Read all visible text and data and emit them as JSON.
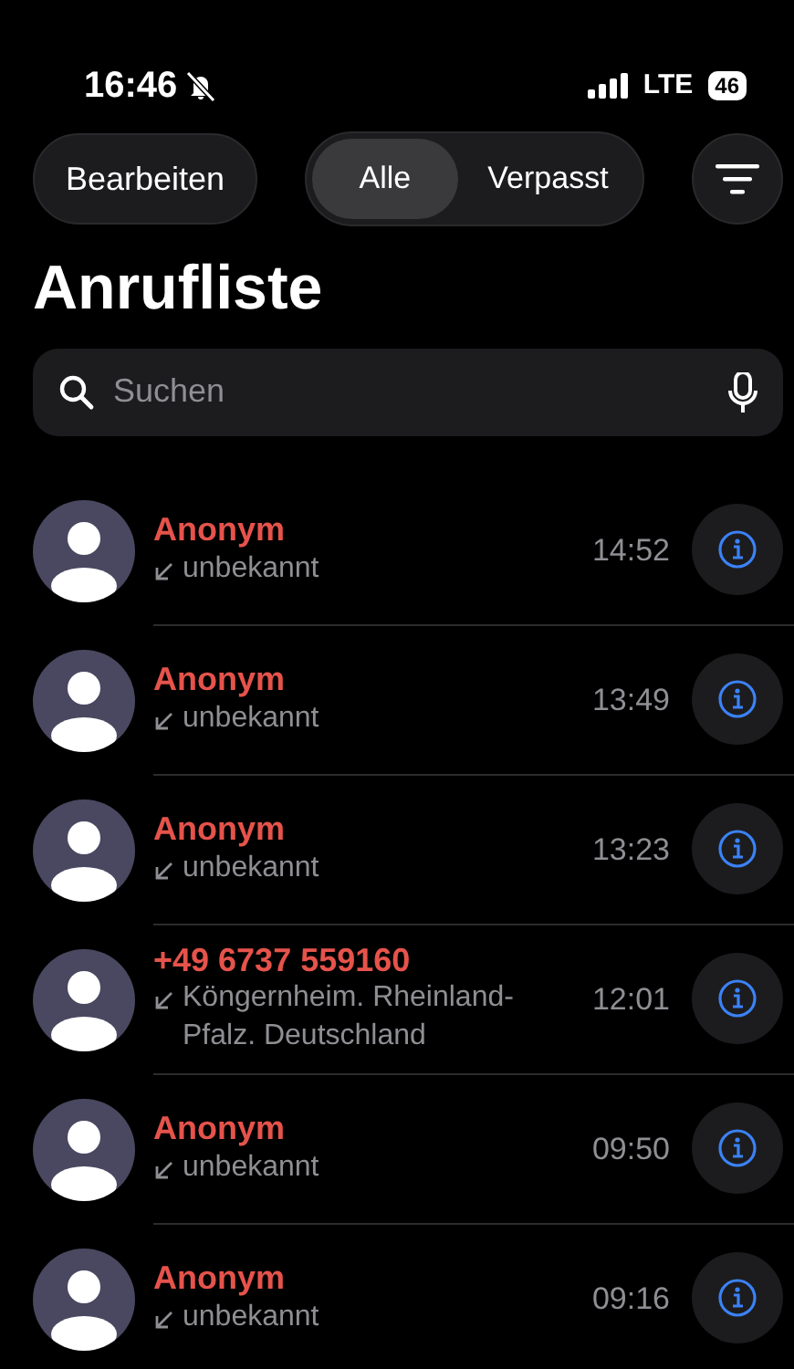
{
  "status_bar": {
    "time": "16:46",
    "silent": true,
    "network": "LTE",
    "battery": "46"
  },
  "toolbar": {
    "edit": "Bearbeiten",
    "filter_tabs": [
      {
        "label": "Alle",
        "selected": true
      },
      {
        "label": "Verpasst",
        "selected": false
      }
    ]
  },
  "title": "Anrufliste",
  "search": {
    "placeholder": "Suchen"
  },
  "calls": [
    {
      "name": "Anonym",
      "detail": "unbekannt",
      "time": "14:52",
      "missed": true
    },
    {
      "name": "Anonym",
      "detail": "unbekannt",
      "time": "13:49",
      "missed": true
    },
    {
      "name": "Anonym",
      "detail": "unbekannt",
      "time": "13:23",
      "missed": true
    },
    {
      "name": "+49 6737 559160",
      "detail": "Köngernheim. Rheinland-Pfalz. Deutschland",
      "time": "12:01",
      "missed": true
    },
    {
      "name": "Anonym",
      "detail": "unbekannt",
      "time": "09:50",
      "missed": true
    },
    {
      "name": "Anonym",
      "detail": "unbekannt",
      "time": "09:16",
      "missed": true
    }
  ]
}
